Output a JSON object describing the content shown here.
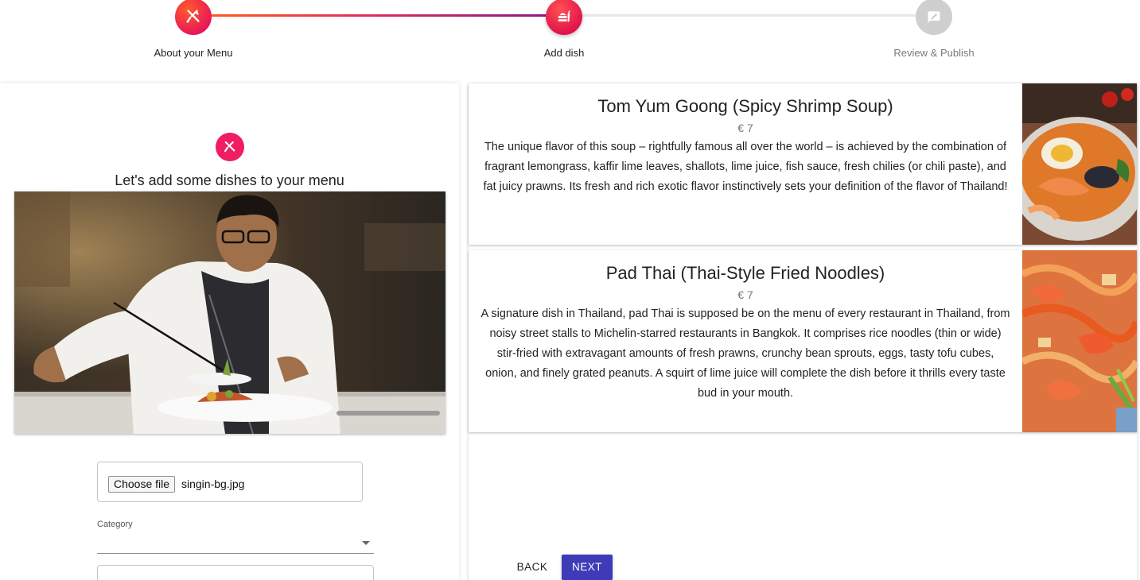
{
  "stepper": {
    "steps": [
      {
        "label": "About your Menu",
        "state": "done",
        "icon": "cutlery-icon"
      },
      {
        "label": "Add dish",
        "state": "active",
        "icon": "food-icon"
      },
      {
        "label": "Review & Publish",
        "state": "pending",
        "icon": "publish-icon"
      }
    ]
  },
  "left": {
    "heading": "Let's add some dishes to your menu",
    "file": {
      "button_label": "Choose file",
      "filename": "singin-bg.jpg"
    },
    "category": {
      "label": "Category",
      "value": ""
    }
  },
  "dishes": [
    {
      "name": "Tom Yum Goong (Spicy Shrimp Soup)",
      "price": "€ 7",
      "description": "The unique flavor of this soup – rightfully famous all over the world – is achieved by the combination of fragrant lemongrass, kaffir lime leaves, shallots, lime juice, fish sauce, fresh chilies (or chili paste), and fat juicy prawns. Its fresh and rich exotic flavor instinctively sets your definition of the flavor of Thailand!"
    },
    {
      "name": "Pad Thai (Thai-Style Fried Noodles)",
      "price": "€ 7",
      "description": "A signature dish in Thailand, pad Thai is supposed be on the menu of every restaurant in Thailand, from noisy street stalls to Michelin-starred restaurants in Bangkok. It comprises rice noodles (thin or wide) stir-fried with extravagant amounts of fresh prawns, crunchy bean sprouts, eggs, tasty tofu cubes, onion, and finely grated peanuts. A squirt of lime juice will complete the dish before it thrills every taste bud in your mouth."
    }
  ],
  "nav": {
    "back_label": "BACK",
    "next_label": "NEXT"
  },
  "colors": {
    "accent_pink": "#f01d62",
    "accent_orange": "#ff6a00",
    "accent_purple": "#8a1a8a",
    "next_button": "#3f3bb8",
    "pending_gray": "#cccccc"
  }
}
